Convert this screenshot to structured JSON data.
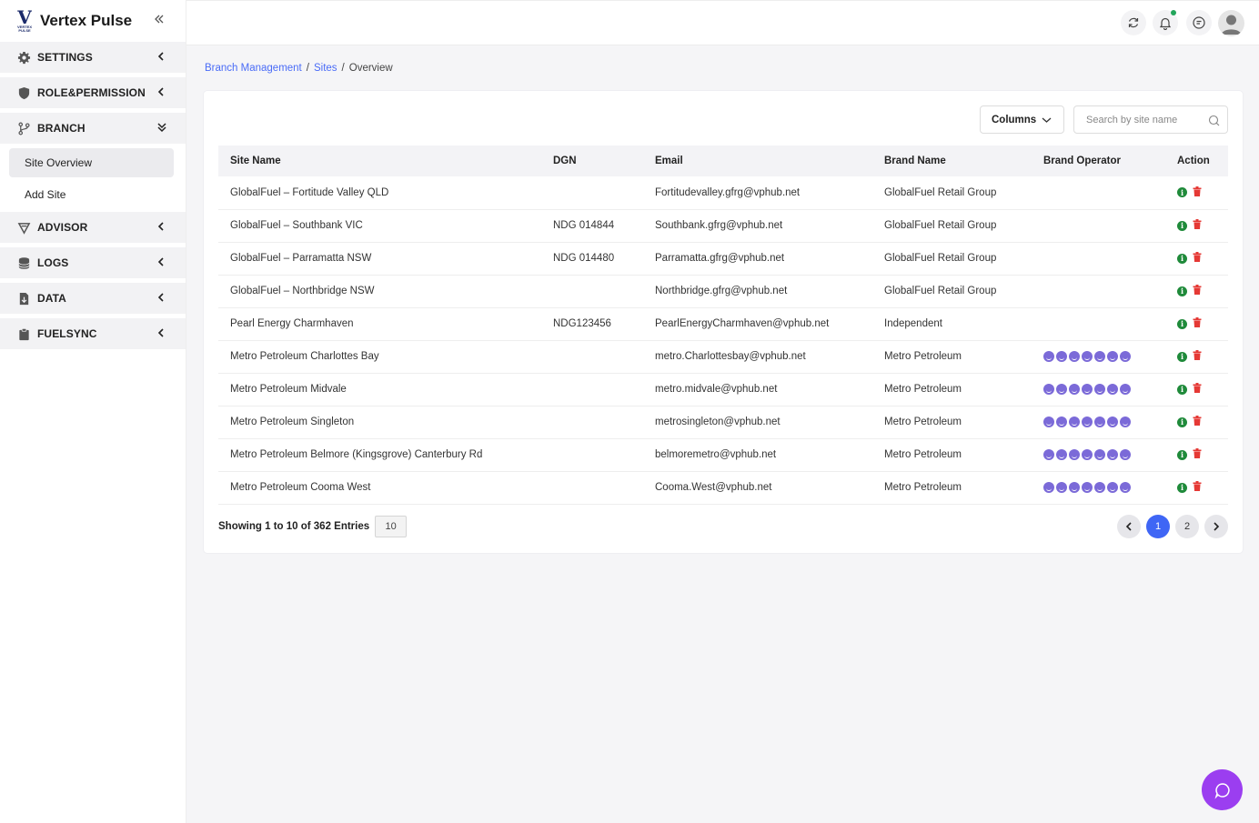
{
  "app": {
    "name": "Vertex Pulse",
    "logo_letter": "V",
    "logo_tagline": "VERTEX PULSE"
  },
  "sidebar": {
    "sections": [
      {
        "label": "SETTINGS",
        "icon": "gear-icon"
      },
      {
        "label": "ROLE&PERMISSION",
        "icon": "shield-icon"
      },
      {
        "label": "BRANCH",
        "icon": "branch-icon"
      },
      {
        "label": "ADVISOR",
        "icon": "advisor-icon"
      },
      {
        "label": "LOGS",
        "icon": "database-icon"
      },
      {
        "label": "DATA",
        "icon": "document-icon"
      },
      {
        "label": "FUELSYNC",
        "icon": "clipboard-icon"
      }
    ],
    "branch_items": [
      {
        "label": "Site Overview",
        "active": true
      },
      {
        "label": "Add Site",
        "active": false
      }
    ]
  },
  "breadcrumb": {
    "items": [
      "Branch Management",
      "Sites",
      "Overview"
    ],
    "separator": "/"
  },
  "toolbar": {
    "columns_label": "Columns",
    "search_placeholder": "Search by site name"
  },
  "table": {
    "headers": [
      "Site Name",
      "DGN",
      "Email",
      "Brand Name",
      "Brand Operator",
      "Action"
    ],
    "rows": [
      {
        "site": "GlobalFuel – Fortitude Valley QLD",
        "dgn": "",
        "email": "Fortitudevalley.gfrg@vphub.net",
        "brand": "GlobalFuel Retail Group",
        "operators": 0
      },
      {
        "site": "GlobalFuel – Southbank VIC",
        "dgn": "NDG 014844",
        "email": "Southbank.gfrg@vphub.net",
        "brand": "GlobalFuel Retail Group",
        "operators": 0
      },
      {
        "site": "GlobalFuel – Parramatta NSW",
        "dgn": "NDG 014480",
        "email": "Parramatta.gfrg@vphub.net",
        "brand": "GlobalFuel Retail Group",
        "operators": 0
      },
      {
        "site": "GlobalFuel – Northbridge NSW",
        "dgn": "",
        "email": "Northbridge.gfrg@vphub.net",
        "brand": "GlobalFuel Retail Group",
        "operators": 0
      },
      {
        "site": "Pearl Energy Charmhaven",
        "dgn": "NDG123456",
        "email": "PearlEnergyCharmhaven@vphub.net",
        "brand": "Independent",
        "operators": 0
      },
      {
        "site": "Metro Petroleum Charlottes Bay",
        "dgn": "",
        "email": "metro.Charlottesbay@vphub.net",
        "brand": "Metro Petroleum",
        "operators": 7
      },
      {
        "site": "Metro Petroleum Midvale",
        "dgn": "",
        "email": "metro.midvale@vphub.net",
        "brand": "Metro Petroleum",
        "operators": 7
      },
      {
        "site": "Metro Petroleum Singleton",
        "dgn": "",
        "email": "metrosingleton@vphub.net",
        "brand": "Metro Petroleum",
        "operators": 7
      },
      {
        "site": "Metro Petroleum Belmore (Kingsgrove) Canterbury Rd",
        "dgn": "",
        "email": "belmoremetro@vphub.net",
        "brand": "Metro Petroleum",
        "operators": 7
      },
      {
        "site": "Metro Petroleum Cooma West",
        "dgn": "",
        "email": "Cooma.West@vphub.net",
        "brand": "Metro Petroleum",
        "operators": 7
      }
    ]
  },
  "footer": {
    "showing_text": "Showing 1 to 10 of 362 Entries",
    "per_page": "10",
    "pages": [
      "1",
      "2"
    ],
    "current_page": "1"
  },
  "colors": {
    "accent": "#3f66f5",
    "link": "#4a6cf7",
    "operator": "#7b6ad8",
    "info": "#1f8a3a",
    "delete": "#e53935",
    "chat": "#9b3ef0"
  }
}
